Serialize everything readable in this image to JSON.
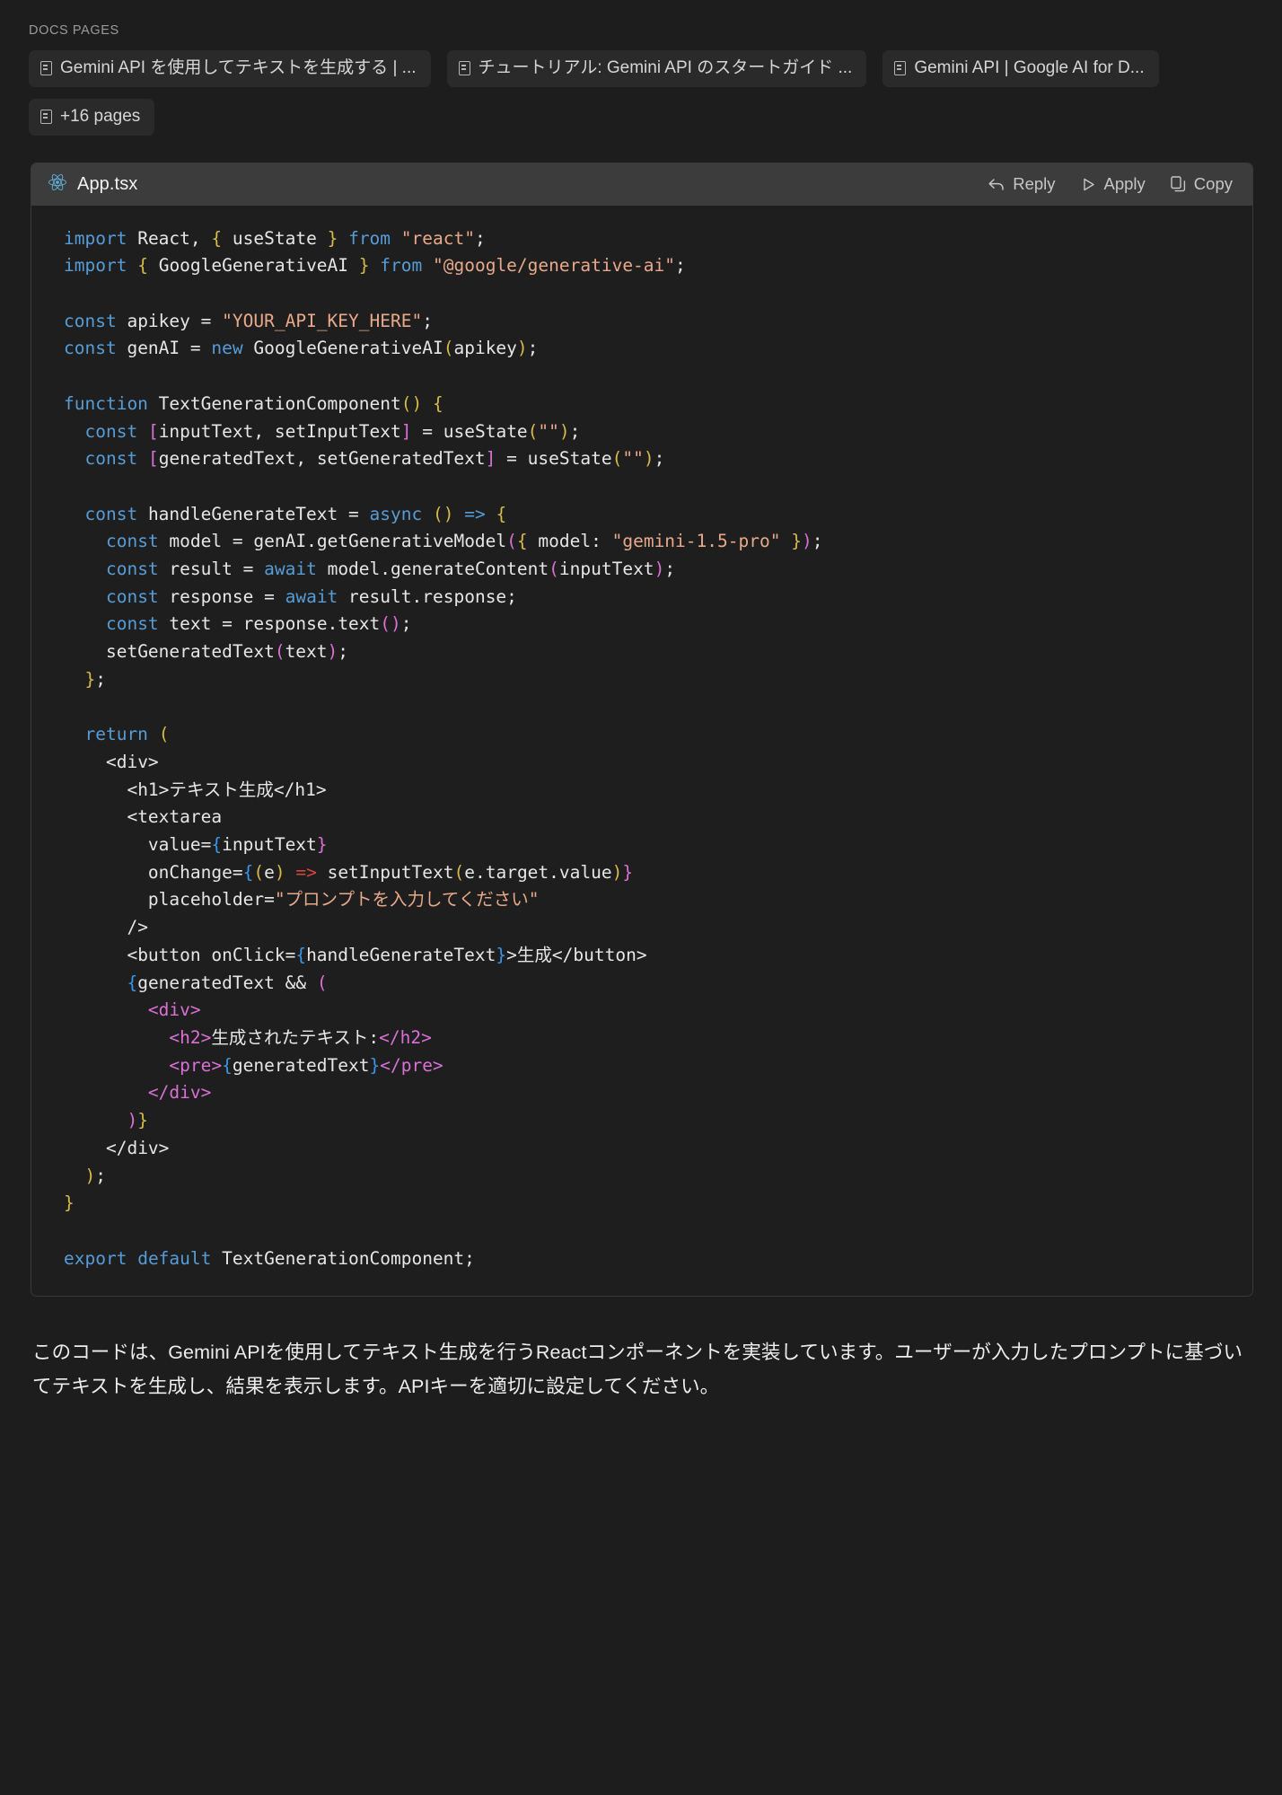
{
  "docs": {
    "label": "DOCS PAGES",
    "chips": [
      {
        "icon": "document-icon",
        "label": "Gemini API を使用してテキストを生成する  |  ..."
      },
      {
        "icon": "document-icon",
        "label": "チュートリアル: Gemini API のスタートガイド  ..."
      },
      {
        "icon": "document-icon",
        "label": "Gemini API  |  Google AI for D..."
      },
      {
        "icon": "document-icon",
        "label": "+16 pages"
      }
    ]
  },
  "code_card": {
    "icon": "react-logo-icon",
    "file_name": "App.tsx",
    "actions": [
      {
        "icon": "reply-arrow-icon",
        "label": "Reply"
      },
      {
        "icon": "play-triangle-icon",
        "label": "Apply"
      },
      {
        "icon": "copy-icon",
        "label": "Copy"
      }
    ],
    "language": "tsx",
    "source": "import React, { useState } from \"react\";\nimport { GoogleGenerativeAI } from \"@google/generative-ai\";\n\nconst apikey = \"YOUR_API_KEY_HERE\";\nconst genAI = new GoogleGenerativeAI(apikey);\n\nfunction TextGenerationComponent() {\n  const [inputText, setInputText] = useState(\"\");\n  const [generatedText, setGeneratedText] = useState(\"\");\n\n  const handleGenerateText = async () => {\n    const model = genAI.getGenerativeModel({ model: \"gemini-1.5-pro\" });\n    const result = await model.generateContent(inputText);\n    const response = await result.response;\n    const text = response.text();\n    setGeneratedText(text);\n  };\n\n  return (\n    <div>\n      <h1>テキスト生成</h1>\n      <textarea\n        value={inputText}\n        onChange={(e) => setInputText(e.target.value)}\n        placeholder=\"プロンプトを入力してください\"\n      />\n      <button onClick={handleGenerateText}>生成</button>\n      {generatedText && (\n        <div>\n          <h2>生成されたテキスト:</h2>\n          <pre>{generatedText}</pre>\n        </div>\n      )}\n    </div>\n  );\n}\n\nexport default TextGenerationComponent;"
  },
  "explanation": {
    "text": "このコードは、Gemini APIを使用してテキスト生成を行うReactコンポーネントを実装しています。ユーザーが入力したプロンプトに基づいてテキストを生成し、結果を表示します。APIキーを適切に設定してください。"
  },
  "colors": {
    "page_background": "#1d1d1d",
    "card_background": "#1e1e1e",
    "card_header_background": "#3c3c3c",
    "chip_background": "#2a2a2a",
    "keyword": "#569cd6",
    "string": "#e8a98a",
    "bracket_yellow": "#d7ba49",
    "bracket_magenta": "#da70d6",
    "bracket_blue": "#3a95e8",
    "arrow_red": "#d1483a",
    "plain_text": "#e6e6e6"
  }
}
